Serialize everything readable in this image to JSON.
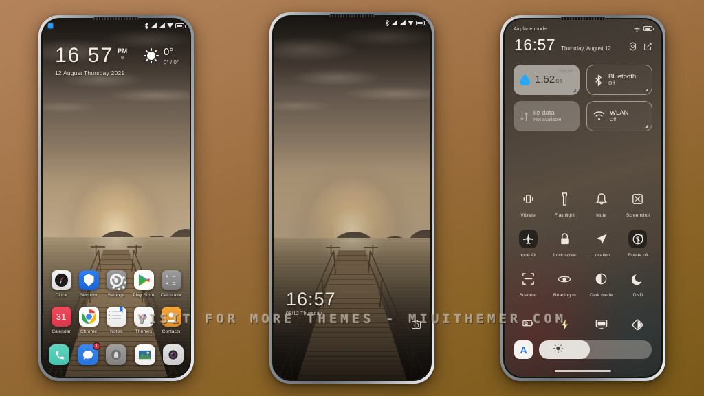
{
  "background": {
    "color_top": "#b4835c",
    "color_bottom": "#7a5a18"
  },
  "watermark": {
    "text": "VISIT FOR MORE  THEMES  -  MIUITHEMER.COM"
  },
  "phone1": {
    "name": "home-screen",
    "statusbar": {
      "notification_indicator": "notification-square-icon",
      "icons": [
        "bluetooth-icon",
        "signal-icon",
        "signal-icon",
        "wifi-icon",
        "battery-icon"
      ]
    },
    "clock_widget": {
      "hours": "16",
      "minutes": "57",
      "ampm": "PM",
      "alarm_icon": "alarm-icon",
      "date": "12 August Thursday 2021"
    },
    "weather_widget": {
      "icon": "sun-icon",
      "temperature": "0°",
      "range": "0° / 0°"
    },
    "apps": [
      [
        {
          "label": "Clock",
          "icon": "clock-app-icon"
        },
        {
          "label": "Security",
          "icon": "security-app-icon"
        },
        {
          "label": "Settings",
          "icon": "settings-app-icon"
        },
        {
          "label": "Play Store",
          "icon": "play-store-app-icon"
        },
        {
          "label": "Calculator",
          "icon": "calculator-app-icon"
        }
      ],
      [
        {
          "label": "Calendar",
          "icon": "calendar-app-icon",
          "day": "31"
        },
        {
          "label": "Chrome",
          "icon": "chrome-app-icon"
        },
        {
          "label": "Notes",
          "icon": "notes-app-icon"
        },
        {
          "label": "Themes",
          "icon": "themes-app-icon"
        },
        {
          "label": "Contacts",
          "icon": "contacts-app-icon"
        }
      ]
    ],
    "dock": [
      {
        "label": "Phone",
        "icon": "phone-app-icon"
      },
      {
        "label": "Messages",
        "icon": "messages-app-icon",
        "badge": "1"
      },
      {
        "label": "Browser",
        "icon": "browser-app-icon"
      },
      {
        "label": "Gallery",
        "icon": "gallery-app-icon"
      },
      {
        "label": "Camera",
        "icon": "camera-app-icon"
      }
    ]
  },
  "phone2": {
    "name": "lock-screen",
    "statusbar": {
      "icons": [
        "bluetooth-icon",
        "signal-icon",
        "signal-icon",
        "wifi-icon",
        "battery-icon"
      ]
    },
    "clock": {
      "time": "16:57",
      "date": "08/12  Thursday"
    },
    "camera_shortcut": "camera-icon"
  },
  "phone3": {
    "name": "control-center",
    "statusbar": {
      "left_text": "Airplane mode",
      "right_icons": [
        "airplane-icon",
        "battery-icon"
      ]
    },
    "header": {
      "time": "16:57",
      "date": "Thursday, August 12",
      "settings_icon": "settings-gear-icon",
      "edit_icon": "edit-icon"
    },
    "tiles": [
      {
        "title": "",
        "sub": "",
        "icon": "data-drop-icon",
        "used_label": "Used in",
        "amount": "1.52",
        "unit": "GB",
        "state": "on"
      },
      {
        "title": "Bluetooth",
        "sub": "Off",
        "icon": "bluetooth-icon",
        "state": "off"
      },
      {
        "title": "ile data",
        "sub": "Not available",
        "icon": "mobile-data-icon",
        "state": "disabled"
      },
      {
        "title": "WLAN",
        "sub": "Off",
        "icon": "wifi-icon",
        "state": "off"
      }
    ],
    "toggles": [
      [
        {
          "label": "Vibrate",
          "icon": "vibrate-icon",
          "active": false
        },
        {
          "label": "Flashlight",
          "icon": "flashlight-icon",
          "active": false
        },
        {
          "label": "Mute",
          "icon": "bell-mute-icon",
          "active": false
        },
        {
          "label": "Screenshot",
          "icon": "screenshot-icon",
          "active": false
        }
      ],
      [
        {
          "label": "node   Air",
          "icon": "airplane-icon",
          "active": true
        },
        {
          "label": "Lock scree",
          "icon": "lock-icon",
          "active": false
        },
        {
          "label": "Location",
          "icon": "location-icon",
          "active": false
        },
        {
          "label": "Rotate off",
          "icon": "rotate-lock-icon",
          "active": true
        }
      ],
      [
        {
          "label": "Scanner",
          "icon": "scanner-icon",
          "active": false
        },
        {
          "label": "Reading m",
          "icon": "reading-mode-eye-icon",
          "active": false
        },
        {
          "label": "Dark mode",
          "icon": "dark-mode-icon",
          "active": false
        },
        {
          "label": "DND",
          "icon": "moon-dnd-icon",
          "active": false
        }
      ]
    ],
    "bottom_icons": [
      "battery-saver-icon",
      "lightning-icon",
      "cast-screen-icon",
      "contrast-icon"
    ],
    "brightness": {
      "auto_label": "A",
      "icon": "brightness-sun-icon",
      "level_percent": 45
    }
  }
}
